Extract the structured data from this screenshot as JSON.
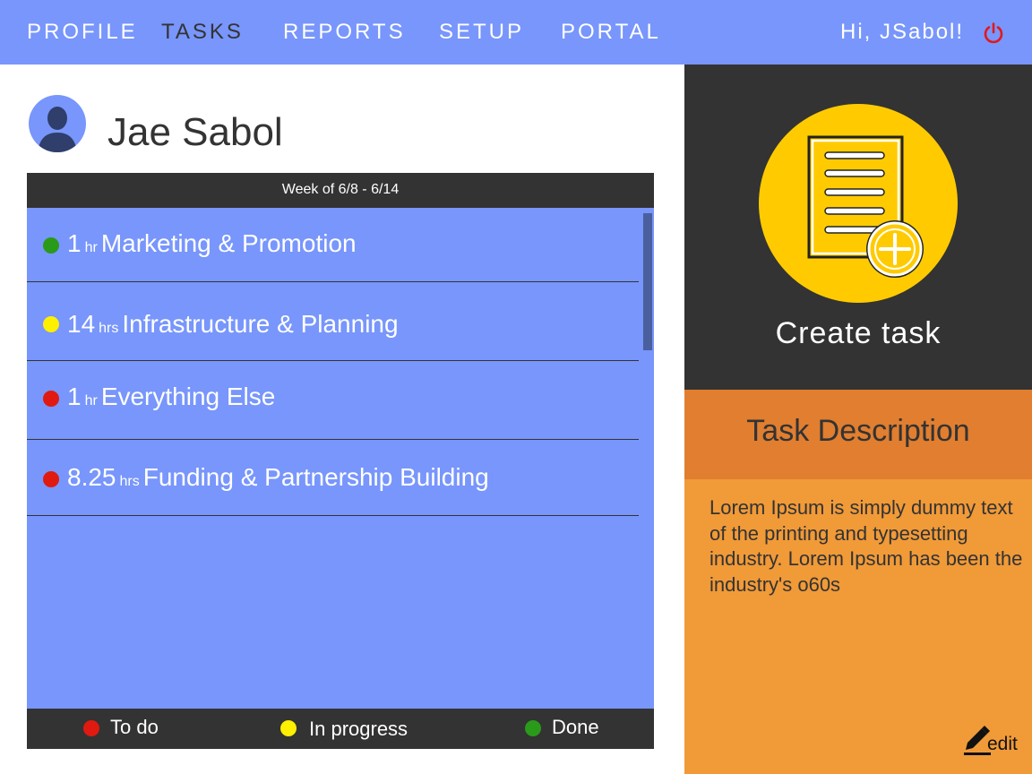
{
  "nav": {
    "items": [
      {
        "label": "PROFILE",
        "active": false
      },
      {
        "label": "TASKS",
        "active": true
      },
      {
        "label": "REPORTS",
        "active": false
      },
      {
        "label": "SETUP",
        "active": false
      },
      {
        "label": "PORTAL",
        "active": false
      }
    ],
    "greeting": "Hi, JSabol!",
    "power_icon": "power-icon",
    "power_color": "#e0191b"
  },
  "user": {
    "name": "Jae Sabol",
    "avatar_icon": "user-silhouette-icon"
  },
  "tasks": {
    "week_label": "Week of 6/8 - 6/14",
    "items": [
      {
        "status": "done",
        "color": "#2a9a1a",
        "amount": "1",
        "unit": "hr",
        "name": "Marketing & Promotion"
      },
      {
        "status": "in-progress",
        "color": "#ffef00",
        "amount": "14",
        "unit": "hrs",
        "name": "Infrastructure & Planning"
      },
      {
        "status": "to-do",
        "color": "#e01a10",
        "amount": "1",
        "unit": "hr",
        "name": "Everything Else"
      },
      {
        "status": "to-do",
        "color": "#e01a10",
        "amount": "8.25",
        "unit": "hrs",
        "name": "Funding & Partnership Building"
      }
    ],
    "legend": [
      {
        "label": "To do",
        "color": "#e01a10"
      },
      {
        "label": "In progress",
        "color": "#ffef00"
      },
      {
        "label": "Done",
        "color": "#2a9a1a"
      }
    ]
  },
  "create": {
    "label": "Create task",
    "icon": "document-add-icon"
  },
  "description": {
    "title": "Task Description",
    "text": "Lorem Ipsum is simply dummy text of the printing and typesetting industry. Lorem Ipsum has been the industry's o60s",
    "edit_label": "edit",
    "edit_icon": "pencil-icon"
  },
  "colors": {
    "nav_bg": "#7896fb",
    "panel_bg": "#7896fb",
    "dark": "#333333",
    "accent_yellow": "#ffcb00",
    "desc_header": "#e17e2f",
    "desc_body": "#f19a38"
  }
}
